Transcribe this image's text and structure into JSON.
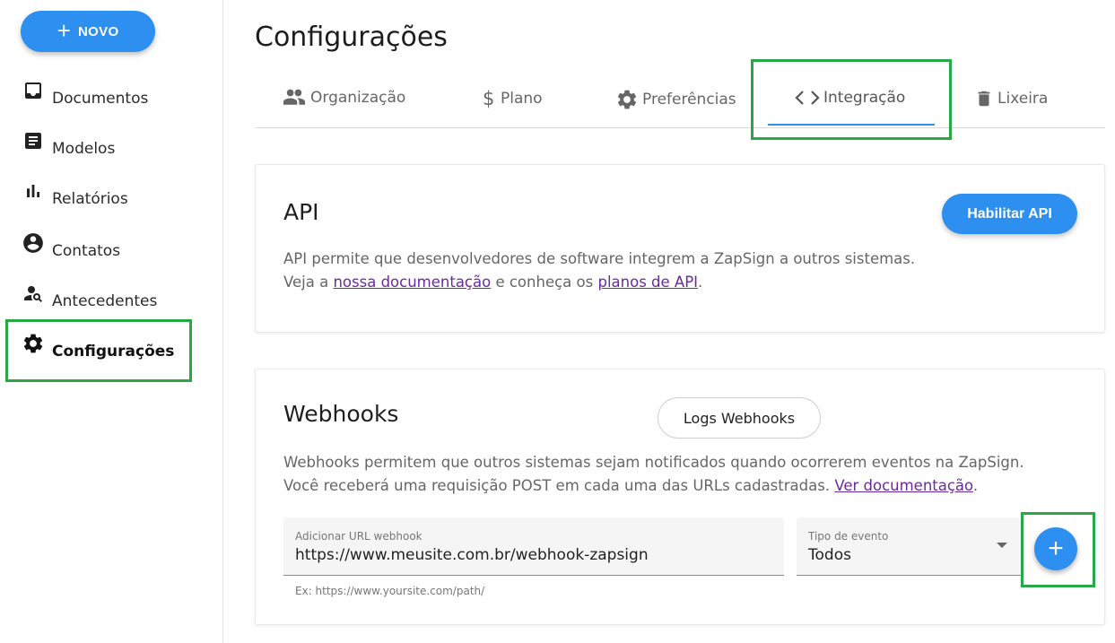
{
  "sidebar": {
    "new_button": {
      "icon": "plus-icon",
      "label": "NOVO"
    },
    "items": [
      {
        "icon": "inbox-icon",
        "label": "Documentos"
      },
      {
        "icon": "document-icon",
        "label": "Modelos"
      },
      {
        "icon": "bar-chart-icon",
        "label": "Relatórios"
      },
      {
        "icon": "account-circle-icon",
        "label": "Contatos"
      },
      {
        "icon": "person-search-icon",
        "label": "Antecedentes"
      },
      {
        "icon": "gear-icon",
        "label": "Configurações",
        "active": true
      }
    ]
  },
  "page": {
    "title": "Configurações"
  },
  "tabs": [
    {
      "icon": "people-icon",
      "label": "Organização"
    },
    {
      "icon": "dollar-icon",
      "label": "Plano"
    },
    {
      "icon": "gear-icon",
      "label": "Preferências"
    },
    {
      "icon": "code-icon",
      "label": "Integração",
      "active": true
    },
    {
      "icon": "trash-icon",
      "label": "Lixeira"
    }
  ],
  "api_card": {
    "title": "API",
    "enable_button": "Habilitar API",
    "description_line1": "API permite que desenvolvedores de software integrem a ZapSign a outros sistemas.",
    "line2_prefix": "Veja a ",
    "docs_link": "nossa documentação",
    "line2_middle": " e conheça os ",
    "plans_link": "planos de API",
    "line2_suffix": "."
  },
  "webhooks_card": {
    "title": "Webhooks",
    "logs_button": "Logs Webhooks",
    "description_line1": "Webhooks permitem que outros sistemas sejam notificados quando ocorrerem eventos na ZapSign.",
    "line2_prefix": "Você receberá uma requisição POST em cada uma das URLs cadastradas. ",
    "docs_link": "Ver documentação",
    "line2_suffix": ".",
    "url_field": {
      "label": "Adicionar URL webhook",
      "value": "https://www.meusite.com.br/webhook-zapsign",
      "hint": "Ex: https://www.yoursite.com/path/"
    },
    "event_select": {
      "label": "Tipo de evento",
      "value": "Todos"
    },
    "add_button": "+"
  },
  "colors": {
    "accent": "#2d8ff0",
    "highlight": "#28a745",
    "link": "#6b2a9a"
  }
}
